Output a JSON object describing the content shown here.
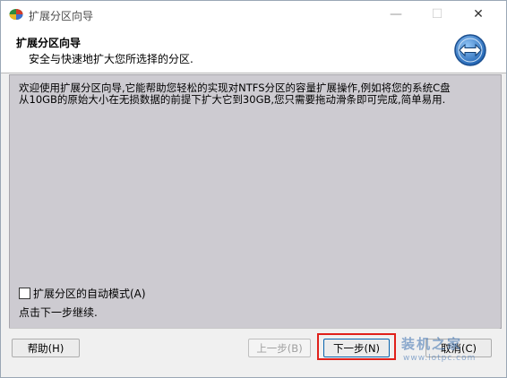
{
  "window": {
    "title": "扩展分区向导",
    "controls": {
      "minimize": "—",
      "maximize": "☐",
      "close": "✕"
    }
  },
  "header": {
    "title": "扩展分区向导",
    "subtitle": "安全与快速地扩大您所选择的分区."
  },
  "content": {
    "description": "欢迎使用扩展分区向导,它能帮助您轻松的实现对NTFS分区的容量扩展操作,例如将您的系统C盘从10GB的原始大小在无损数据的前提下扩大它到30GB,您只需要拖动滑条即可完成,简单易用.",
    "auto_mode_label": "扩展分区的自动模式(A)",
    "auto_mode_checked": false,
    "hint": "点击下一步继续."
  },
  "buttons": {
    "help": "帮助(H)",
    "back": "上一步(B)",
    "next": "下一步(N)",
    "cancel": "取消(C)"
  },
  "watermark": {
    "main": "装机之家",
    "url": "www.lotpc.com"
  },
  "colors": {
    "content_bg": "#cdcbd1",
    "highlight_border": "#e0201a",
    "desktop": "#1f6fb8"
  }
}
